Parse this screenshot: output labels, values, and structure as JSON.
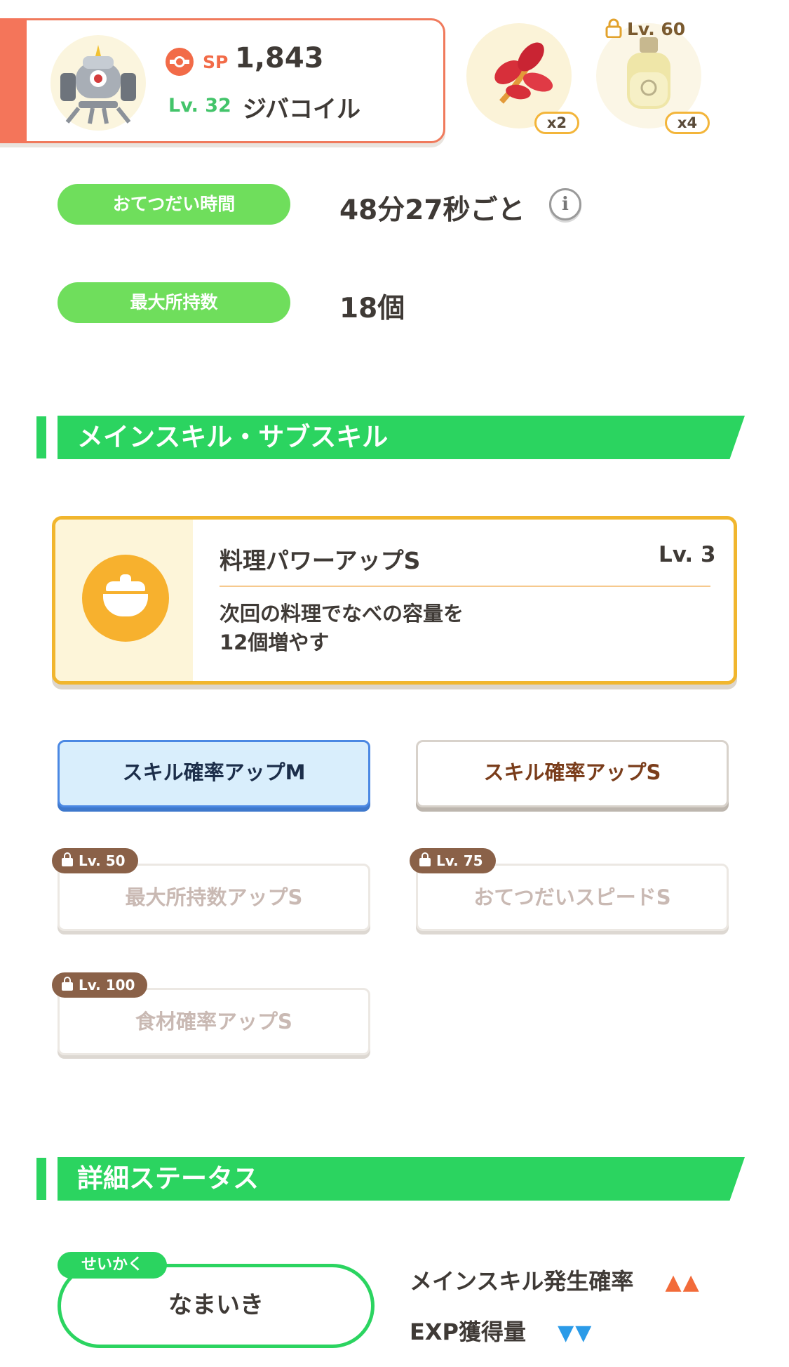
{
  "pokemon": {
    "sp_label": "SP",
    "sp_value": "1,843",
    "level_label": "Lv. 32",
    "name": "ジバコイル"
  },
  "ingredients": [
    {
      "icon": "fiery-herb-icon",
      "count": "x2"
    },
    {
      "icon": "oil-bottle-icon",
      "count": "x4",
      "unlock_level": "Lv. 60"
    }
  ],
  "stats": {
    "help_time_label": "おてつだい時間",
    "help_time_value": "48分27秒ごと",
    "max_carry_label": "最大所持数",
    "max_carry_value": "18個"
  },
  "section_skills": {
    "title": "メインスキル・サブスキル"
  },
  "main_skill": {
    "name": "料理パワーアップS",
    "level": "Lv. 3",
    "description_line1": "次回の料理でなべの容量を",
    "description_line2": "12個増やす"
  },
  "sub_skills": [
    {
      "label": "スキル確率アップM",
      "state": "selected"
    },
    {
      "label": "スキル確率アップS",
      "state": "unlocked"
    },
    {
      "label": "最大所持数アップS",
      "state": "locked",
      "unlock_level": "Lv. 50"
    },
    {
      "label": "おてつだいスピードS",
      "state": "locked",
      "unlock_level": "Lv. 75"
    },
    {
      "label": "食材確率アップS",
      "state": "locked",
      "unlock_level": "Lv. 100"
    }
  ],
  "section_details": {
    "title": "詳細ステータス"
  },
  "nature": {
    "tag": "せいかく",
    "value": "なまいき",
    "up_effect": "メインスキル発生確率",
    "up_arrows": "▲▲",
    "down_effect": "EXP獲得量",
    "down_arrows": "▼▼"
  },
  "colors": {
    "accent_green": "#2bd460",
    "pill_green": "#6fde5c",
    "sp_red": "#f26b48",
    "skill_gold": "#f1b62e",
    "up_arrow": "#f26b3a",
    "down_arrow": "#2b9be8"
  }
}
